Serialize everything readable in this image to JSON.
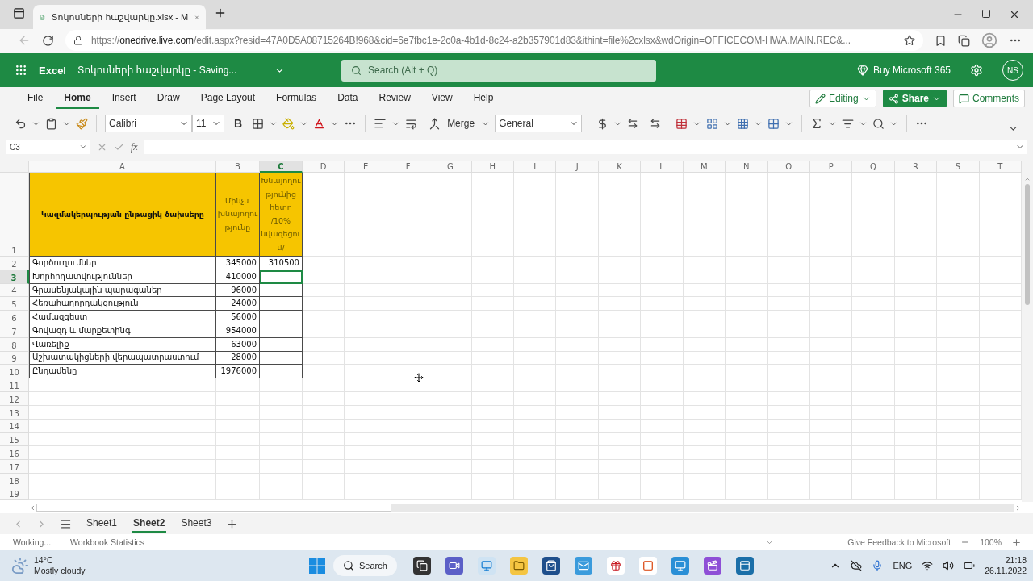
{
  "browser": {
    "tab_title": "Տոկոսների հաշվարկը.xlsx - M",
    "url": {
      "scheme": "https://",
      "host": "onedrive.live.com",
      "path": "/edit.aspx?resid=47A0D5A08715264B!968&cid=6e7fbc1e-2c0a-4b1d-8c24-a2b357901d83&ithint=file%2cxlsx&wdOrigin=OFFICECOM-HWA.MAIN.REC&..."
    }
  },
  "excel": {
    "app": "Excel",
    "document": "Տոկոսների հաշվարկը - Saving...",
    "search_placeholder": "Search (Alt + Q)",
    "buy": "Buy Microsoft 365",
    "user_initials": "NS"
  },
  "ribbon_tabs": [
    {
      "label": "File",
      "selected": false
    },
    {
      "label": "Home",
      "selected": true
    },
    {
      "label": "Insert",
      "selected": false
    },
    {
      "label": "Draw",
      "selected": false
    },
    {
      "label": "Page Layout",
      "selected": false
    },
    {
      "label": "Formulas",
      "selected": false
    },
    {
      "label": "Data",
      "selected": false
    },
    {
      "label": "Review",
      "selected": false
    },
    {
      "label": "View",
      "selected": false
    },
    {
      "label": "Help",
      "selected": false
    }
  ],
  "ribbon_actions": {
    "editing": "Editing",
    "share": "Share",
    "comments": "Comments"
  },
  "toolbar": {
    "font": "Calibri",
    "font_size": "11",
    "bold": "B",
    "merge": "Merge",
    "number_format": "General"
  },
  "formula_bar": {
    "name_box": "C3",
    "fx": "fx"
  },
  "sheet": {
    "columns": [
      {
        "label": "A",
        "selected": false
      },
      {
        "label": "B",
        "selected": false
      },
      {
        "label": "C",
        "selected": true
      },
      {
        "label": "D",
        "selected": false
      },
      {
        "label": "E",
        "selected": false
      },
      {
        "label": "F",
        "selected": false
      },
      {
        "label": "G",
        "selected": false
      },
      {
        "label": "H",
        "selected": false
      },
      {
        "label": "I",
        "selected": false
      },
      {
        "label": "J",
        "selected": false
      },
      {
        "label": "K",
        "selected": false
      },
      {
        "label": "L",
        "selected": false
      },
      {
        "label": "M",
        "selected": false
      },
      {
        "label": "N",
        "selected": false
      },
      {
        "label": "O",
        "selected": false
      },
      {
        "label": "P",
        "selected": false
      },
      {
        "label": "Q",
        "selected": false
      },
      {
        "label": "R",
        "selected": false
      },
      {
        "label": "S",
        "selected": false
      },
      {
        "label": "T",
        "selected": false
      }
    ],
    "rows": [
      {
        "label": "1",
        "selected": false,
        "cells": [
          {
            "kind": "title",
            "text": "Կազմակերպության ընթացիկ ծախսերը",
            "selected": false
          },
          {
            "kind": "header",
            "text": "Մինչև խնայողությունը",
            "selected": false
          },
          {
            "kind": "header",
            "text": "Խնայողությունից հետո /10% նվազեցում/",
            "selected": false
          }
        ]
      },
      {
        "label": "2",
        "selected": false,
        "cells": [
          {
            "kind": "text",
            "text": "Գործուղումներ",
            "selected": false
          },
          {
            "kind": "number",
            "text": "345000",
            "selected": false
          },
          {
            "kind": "number",
            "text": "310500",
            "selected": false
          }
        ]
      },
      {
        "label": "3",
        "selected": true,
        "cells": [
          {
            "kind": "text",
            "text": "Խորհրդատվություններ",
            "selected": false
          },
          {
            "kind": "number",
            "text": "410000",
            "selected": false
          },
          {
            "kind": "empty",
            "selected": true
          }
        ]
      },
      {
        "label": "4",
        "selected": false,
        "cells": [
          {
            "kind": "text",
            "text": "Գրասենյակային պարագաներ",
            "selected": false
          },
          {
            "kind": "number",
            "text": "96000",
            "selected": false
          },
          {
            "kind": "empty",
            "selected": false
          }
        ]
      },
      {
        "label": "5",
        "selected": false,
        "cells": [
          {
            "kind": "text",
            "text": "Հեռահաղորդակցություն",
            "selected": false
          },
          {
            "kind": "number",
            "text": "24000",
            "selected": false
          },
          {
            "kind": "empty",
            "selected": false
          }
        ]
      },
      {
        "label": "6",
        "selected": false,
        "cells": [
          {
            "kind": "text",
            "text": "Համազգեստ",
            "selected": false
          },
          {
            "kind": "number",
            "text": "56000",
            "selected": false
          },
          {
            "kind": "empty",
            "selected": false
          }
        ]
      },
      {
        "label": "7",
        "selected": false,
        "cells": [
          {
            "kind": "text",
            "text": "Գովազդ և մարքետինգ",
            "selected": false
          },
          {
            "kind": "number",
            "text": "954000",
            "selected": false
          },
          {
            "kind": "empty",
            "selected": false
          }
        ]
      },
      {
        "label": "8",
        "selected": false,
        "cells": [
          {
            "kind": "text",
            "text": "Վառելիք",
            "selected": false
          },
          {
            "kind": "number",
            "text": "63000",
            "selected": false
          },
          {
            "kind": "empty",
            "selected": false
          }
        ]
      },
      {
        "label": "9",
        "selected": false,
        "cells": [
          {
            "kind": "text",
            "text": "Աշխատակիցների վերապատրաստում",
            "selected": false
          },
          {
            "kind": "number",
            "text": "28000",
            "selected": false
          },
          {
            "kind": "empty",
            "selected": false
          }
        ]
      },
      {
        "label": "10",
        "selected": false,
        "cells": [
          {
            "kind": "text",
            "text": "Ընդամենը",
            "selected": false
          },
          {
            "kind": "number",
            "text": "1976000",
            "selected": false
          },
          {
            "kind": "empty",
            "selected": false
          }
        ]
      },
      {
        "label": "11",
        "selected": false
      },
      {
        "label": "12",
        "selected": false
      },
      {
        "label": "13",
        "selected": false
      },
      {
        "label": "14",
        "selected": false
      },
      {
        "label": "15",
        "selected": false
      },
      {
        "label": "16",
        "selected": false
      },
      {
        "label": "17",
        "selected": false
      },
      {
        "label": "18",
        "selected": false
      },
      {
        "label": "19",
        "selected": false
      }
    ]
  },
  "sheet_tabs": [
    {
      "label": "Sheet1",
      "selected": false
    },
    {
      "label": "Sheet2",
      "selected": true
    },
    {
      "label": "Sheet3",
      "selected": false
    }
  ],
  "status_bar": {
    "state": "Working...",
    "statistics": "Workbook Statistics",
    "feedback": "Give Feedback to Microsoft",
    "zoom": "100%"
  },
  "taskbar": {
    "temperature": "14°C",
    "weather": "Mostly cloudy",
    "search": "Search",
    "language": "ENG",
    "time": "21:18",
    "date": "26.11.2022"
  }
}
